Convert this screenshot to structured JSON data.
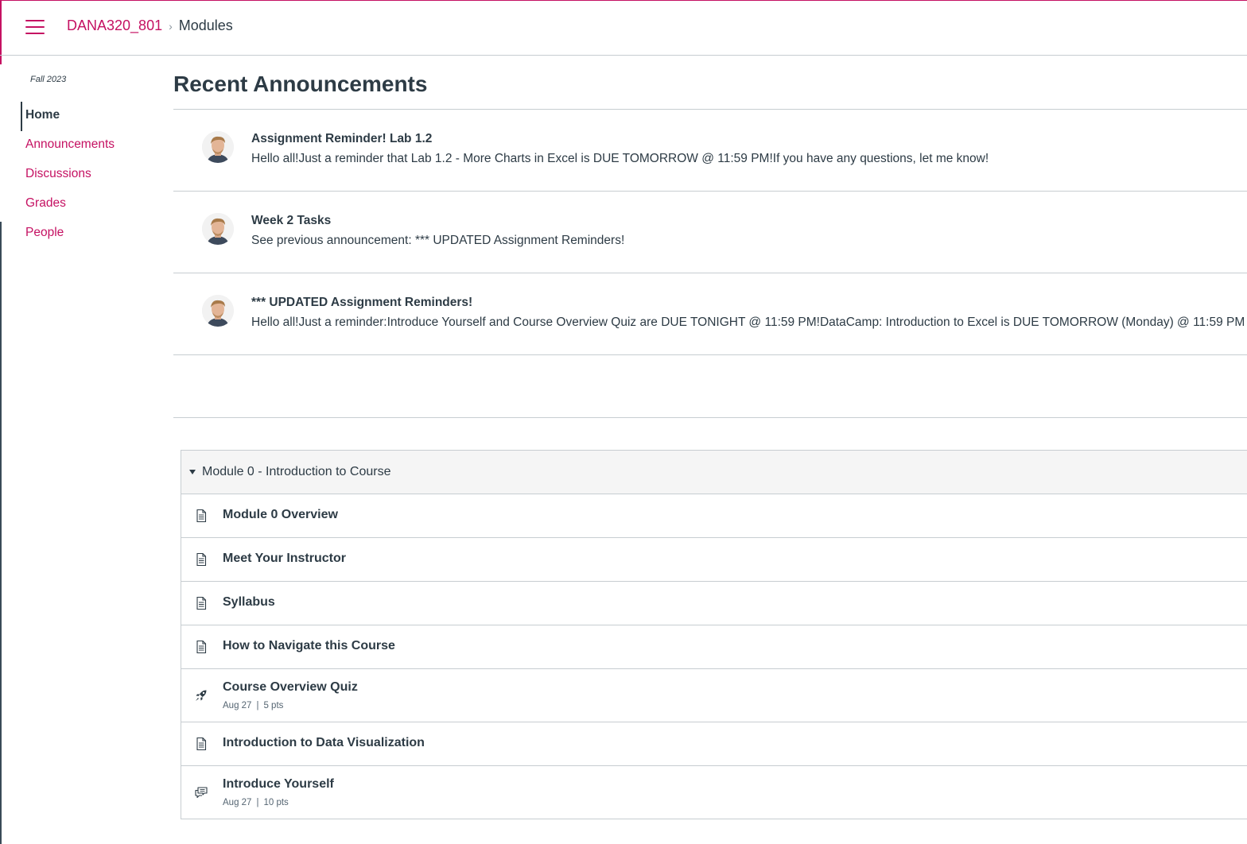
{
  "header": {
    "course_link": "DANA320_801",
    "breadcrumb_separator": "›",
    "current_page": "Modules"
  },
  "sidebar": {
    "term": "Fall 2023",
    "items": [
      {
        "label": "Home",
        "active": true
      },
      {
        "label": "Announcements"
      },
      {
        "label": "Discussions"
      },
      {
        "label": "Grades"
      },
      {
        "label": "People"
      }
    ]
  },
  "announcements": {
    "section_title": "Recent Announcements",
    "items": [
      {
        "title": "Assignment Reminder! Lab 1.2",
        "body": "Hello all!Just a reminder that Lab 1.2 - More Charts in Excel is DUE TOMORROW @ 11:59 PM!If you have any questions, let me know!"
      },
      {
        "title": "Week 2 Tasks",
        "body": "See previous announcement: *** UPDATED Assignment Reminders!"
      },
      {
        "title": "*** UPDATED Assignment Reminders!",
        "body": "Hello all!Just a reminder:Introduce Yourself and Course Overview Quiz are DUE TONIGHT @ 11:59 PM!DataCamp: Introduction to Excel is DUE TOMORROW (Monday) @ 11:59 PM"
      }
    ]
  },
  "module": {
    "title": "Module 0 - Introduction to Course",
    "items": [
      {
        "title": "Module 0 Overview",
        "icon": "page-icon"
      },
      {
        "title": "Meet Your Instructor",
        "icon": "page-icon"
      },
      {
        "title": "Syllabus",
        "icon": "page-icon"
      },
      {
        "title": "How to Navigate this Course",
        "icon": "page-icon"
      },
      {
        "title": "Course Overview Quiz",
        "icon": "quiz-rocket-icon",
        "date": "Aug 27",
        "points": "5 pts"
      },
      {
        "title": "Introduction to Data Visualization",
        "icon": "page-icon"
      },
      {
        "title": "Introduce Yourself",
        "icon": "discussion-icon",
        "date": "Aug 27",
        "points": "10 pts"
      }
    ]
  },
  "colors": {
    "brand": "#c51162",
    "text": "#2d3b45",
    "border": "#c7cdd1",
    "module_header_bg": "#f5f5f5"
  }
}
